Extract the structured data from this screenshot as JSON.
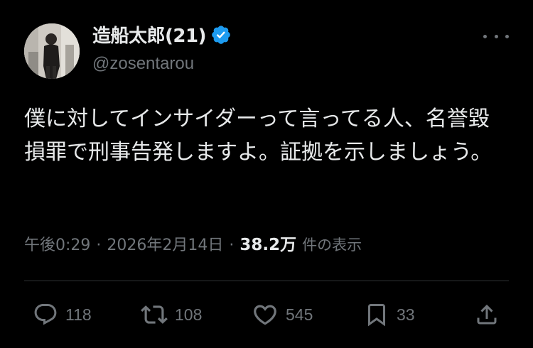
{
  "author": {
    "display_name": "造船太郎(21)",
    "handle": "@zosentarou",
    "verified_icon": "verified-badge-icon",
    "avatar_icon": "profile-photo"
  },
  "tweet": {
    "text": "僕に対してインサイダーって言ってる人、名誉毀損罪で刑事告発しますよ。証拠を示しましょう。"
  },
  "meta": {
    "time": "午後0:29",
    "separator": "·",
    "date": "2026年2月14日",
    "views_count": "38.2万",
    "views_label": "件の表示"
  },
  "actions": {
    "reply": {
      "icon": "reply-icon",
      "count": "118"
    },
    "retweet": {
      "icon": "retweet-icon",
      "count": "108"
    },
    "like": {
      "icon": "heart-icon",
      "count": "545"
    },
    "bookmark": {
      "icon": "bookmark-icon",
      "count": "33"
    },
    "share": {
      "icon": "share-icon"
    }
  },
  "colors": {
    "background": "#000000",
    "text_primary": "#e7e9ea",
    "text_secondary": "#71767b",
    "verified_blue": "#1d9bf0",
    "divider": "#2f3336"
  }
}
